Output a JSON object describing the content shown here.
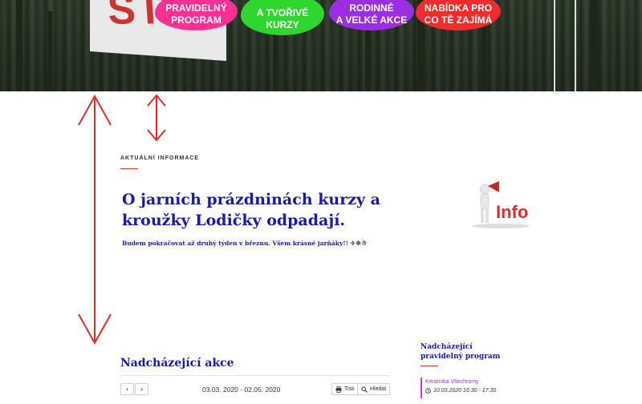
{
  "hero": {
    "banner_text": "STAN",
    "menu": [
      {
        "line1": "PRAVIDELNÝ",
        "line2": "PROGRAM"
      },
      {
        "line1": "A TVOŘIVÉ",
        "line2": "KURZY"
      },
      {
        "line1": "RODINNÉ",
        "line2": "A VELKÉ AKCE"
      },
      {
        "line1": "NABÍDKA PRO",
        "line2": "CO TĚ ZAJÍMÁ"
      }
    ]
  },
  "news": {
    "label": "AKTUÁLNÍ INFORMACE",
    "headline": "O jarních prázdninách kurzy a kroužky Lodičky odpadají.",
    "subline": "Budem pokračovat až druhý týden v březnu. Všem krásné jarňáky!!",
    "image_text": "Info"
  },
  "events": {
    "heading": "Nadcházející akce",
    "date_range": "03.03. 2020 - 02.05. 2020",
    "prev_label": "‹",
    "next_label": "›",
    "print_label": "Tisk",
    "search_label": "Hledat"
  },
  "program": {
    "heading": "Nadcházející pravidelný program",
    "items": [
      {
        "name": "Keramika Všechromy",
        "time": "10.03.2020 16:30 - 17:30"
      }
    ]
  },
  "colors": {
    "accent_blue": "#1a1aa8",
    "accent_red": "#dd3333",
    "pink": "#ff2f93",
    "green": "#2fd62f",
    "purple": "#9b2ee3",
    "red": "#f22b2b",
    "program_border": "#c03bd6"
  }
}
